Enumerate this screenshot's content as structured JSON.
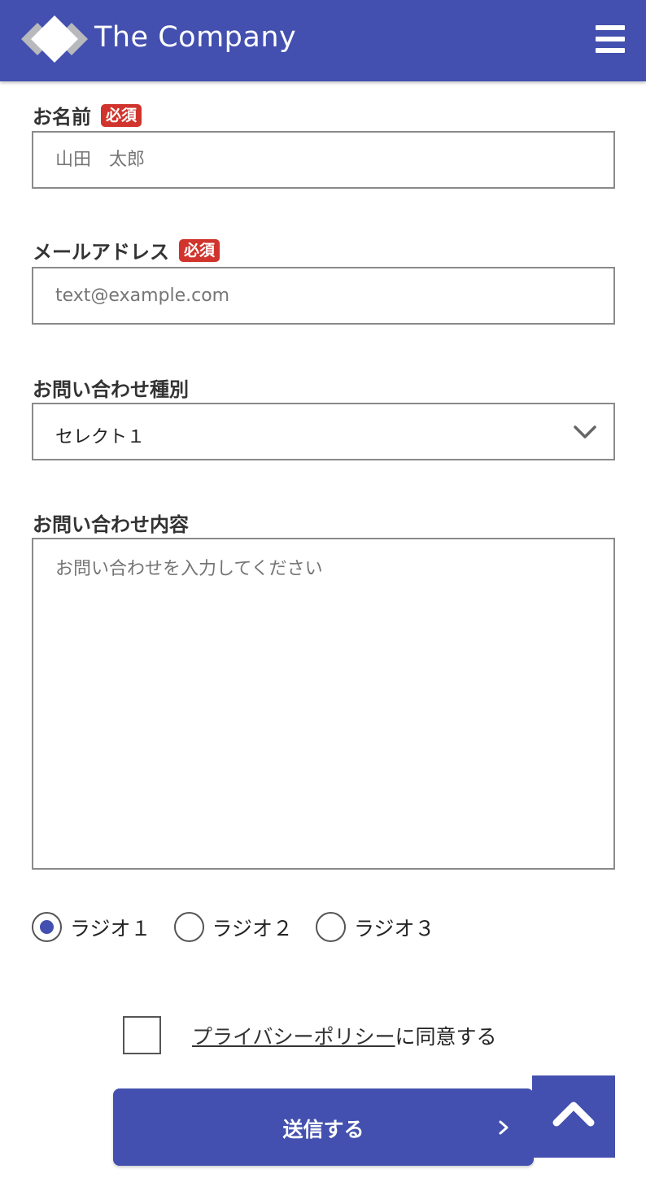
{
  "header": {
    "brand": "The Company",
    "logo_icon": "diamond-logo-icon",
    "menu_icon": "hamburger-menu-icon",
    "color": "#4350af"
  },
  "form": {
    "name": {
      "label": "お名前",
      "required_badge": "必須",
      "placeholder": "山田　太郎"
    },
    "email": {
      "label": "メールアドレス",
      "required_badge": "必須",
      "placeholder": "text@example.com"
    },
    "inquiry_type": {
      "label": "お問い合わせ種別",
      "selected": "セレクト１",
      "icon": "chevron-down-icon"
    },
    "inquiry_content": {
      "label": "お問い合わせ内容",
      "placeholder": "お問い合わせを入力してください"
    },
    "radios": [
      {
        "label": "ラジオ１",
        "checked": true
      },
      {
        "label": "ラジオ２",
        "checked": false
      },
      {
        "label": "ラジオ３",
        "checked": false
      }
    ],
    "consent": {
      "link_text": "プライバシーポリシー",
      "suffix": "に同意する",
      "checked": false
    },
    "submit_label": "送信する",
    "submit_icon": "chevron-right-icon"
  },
  "back_to_top_icon": "chevron-up-icon",
  "colors": {
    "accent": "#4350af",
    "required": "#d0342c"
  }
}
